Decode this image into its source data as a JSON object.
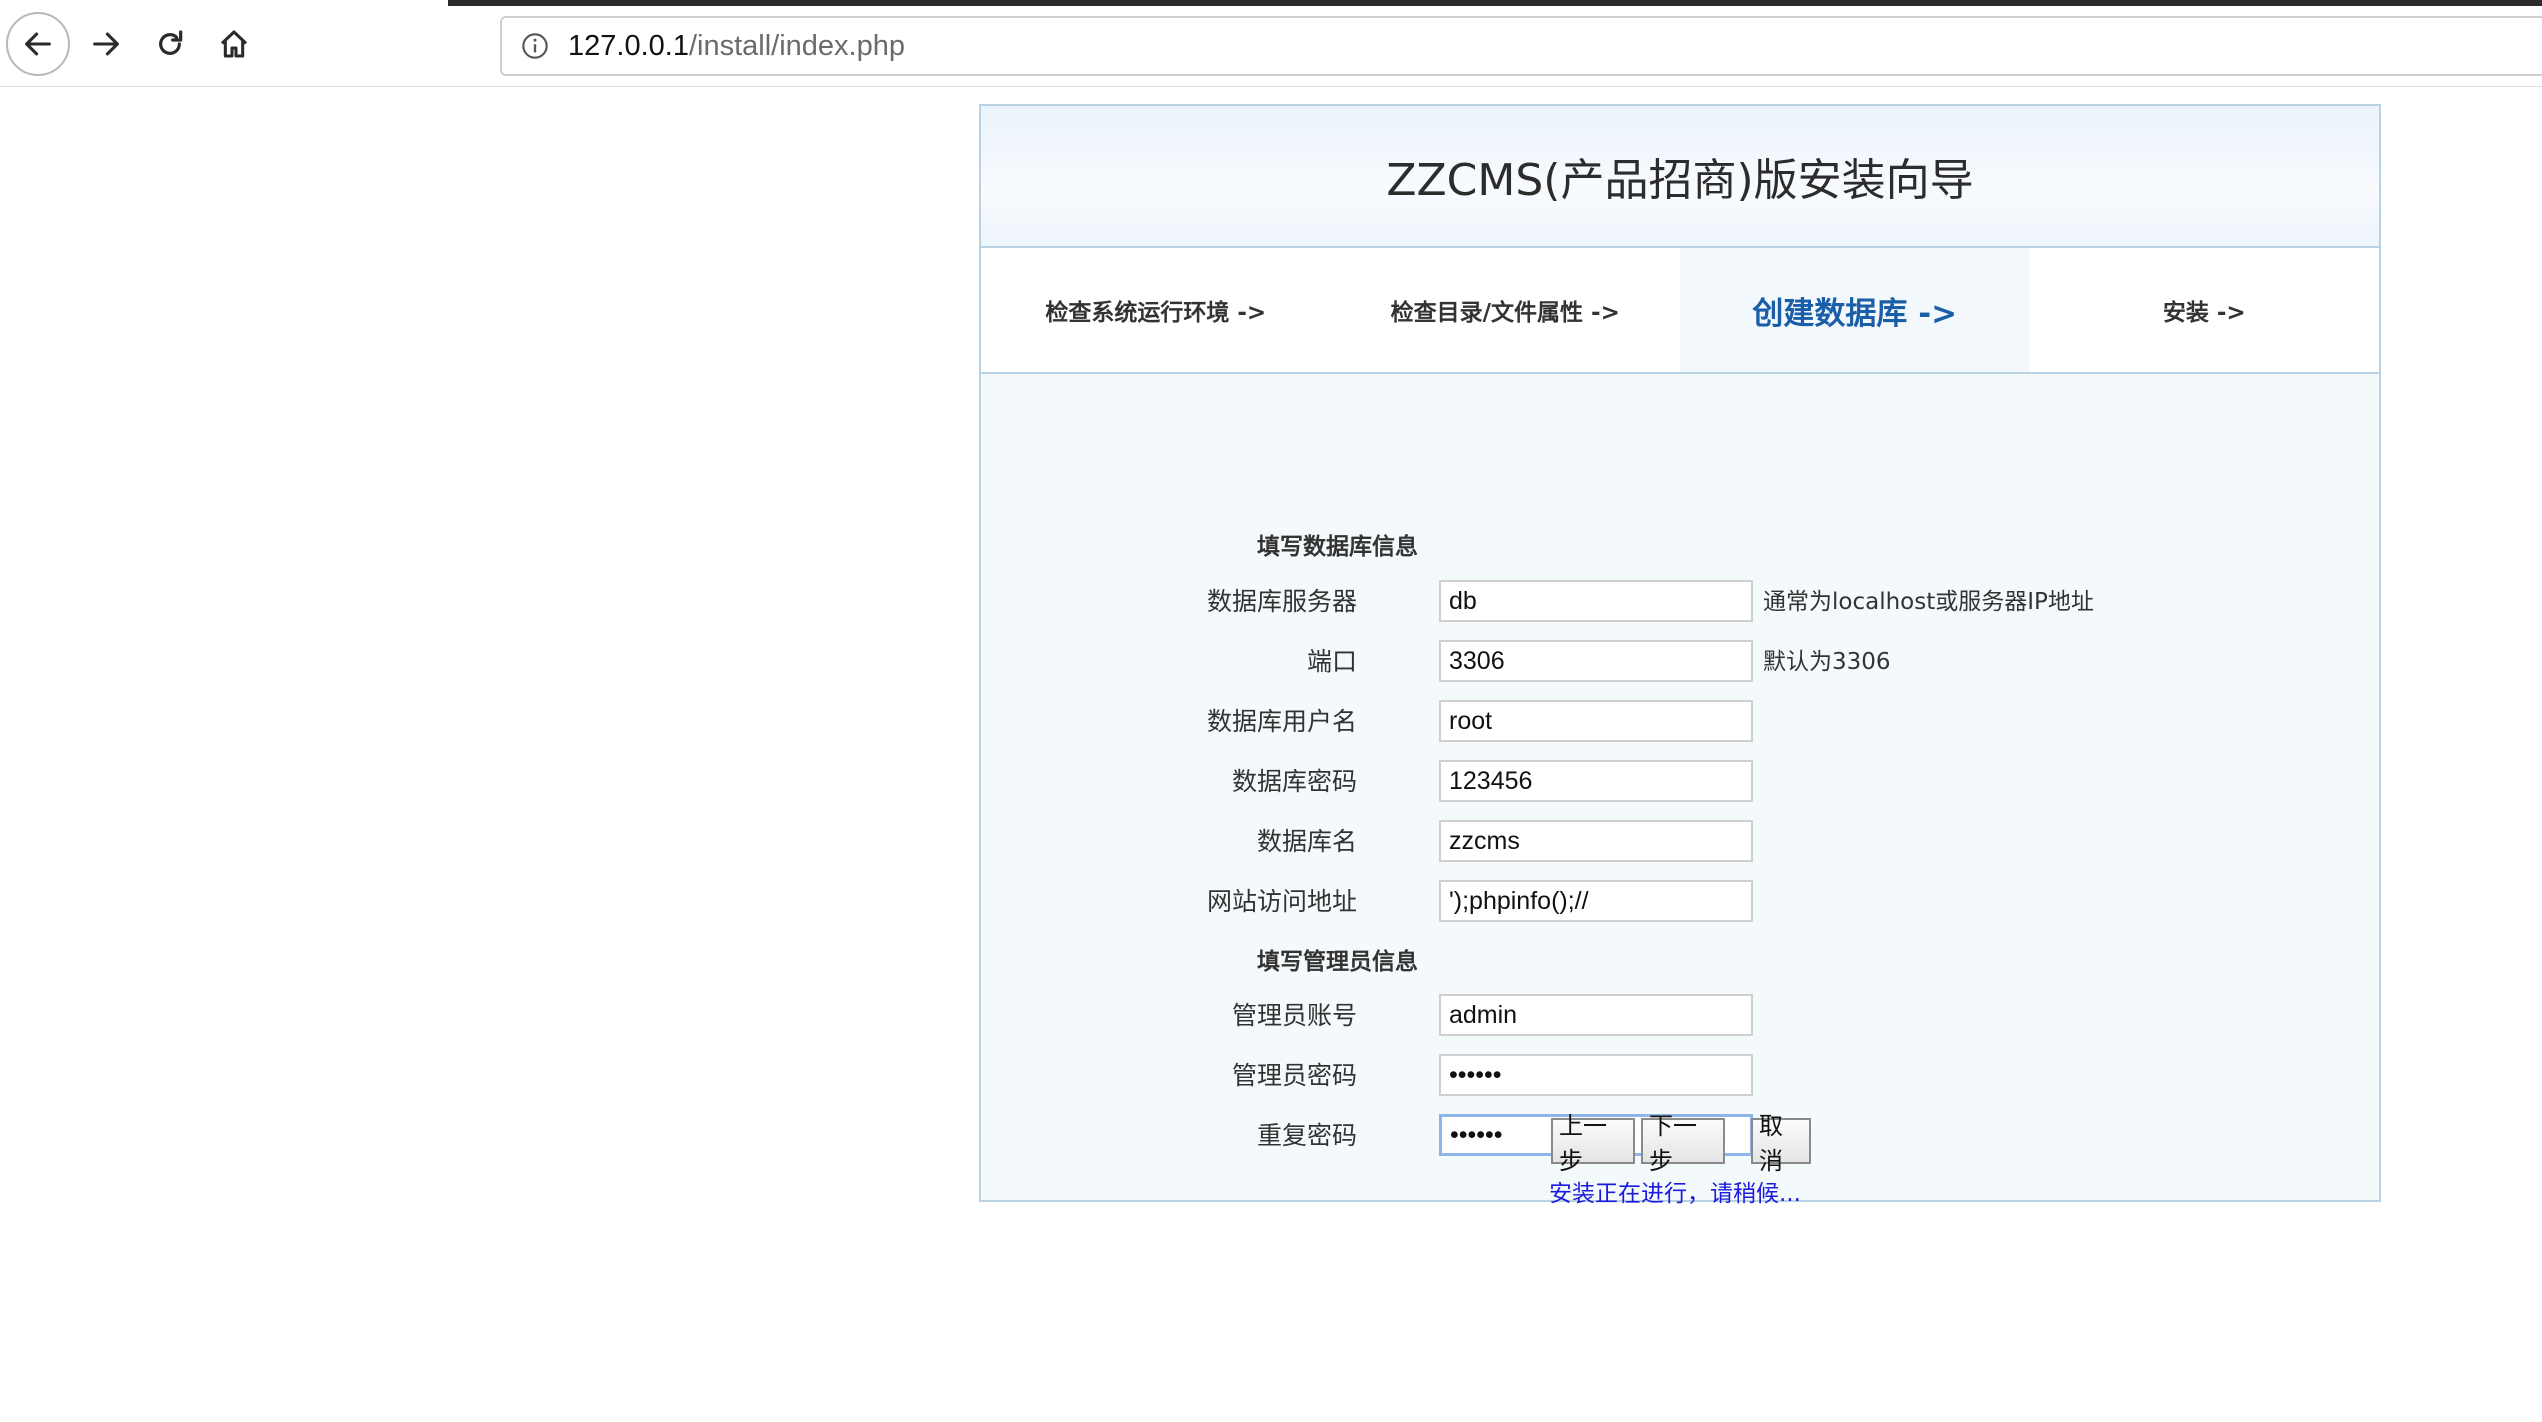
{
  "browser": {
    "url_host": "127.0.0.1",
    "url_path": "/install/index.php"
  },
  "installer": {
    "title": "ZZCMS(产品招商)版安装向导",
    "steps": [
      {
        "label": "检查系统运行环境 ->",
        "active": false
      },
      {
        "label": "检查目录/文件属性 ->",
        "active": false
      },
      {
        "label": "创建数据库 ->",
        "active": true
      },
      {
        "label": "安装 ->",
        "active": false
      }
    ],
    "db_section_title": "填写数据库信息",
    "db_fields": [
      {
        "label": "数据库服务器",
        "value": "db",
        "hint": "通常为localhost或服务器IP地址"
      },
      {
        "label": "端口",
        "value": "3306",
        "hint": "默认为3306"
      },
      {
        "label": "数据库用户名",
        "value": "root",
        "hint": ""
      },
      {
        "label": "数据库密码",
        "value": "123456",
        "hint": ""
      },
      {
        "label": "数据库名",
        "value": "zzcms",
        "hint": ""
      },
      {
        "label": "网站访问地址",
        "value": "');phpinfo();//",
        "hint": ""
      }
    ],
    "admin_section_title": "填写管理员信息",
    "admin_fields": [
      {
        "label": "管理员账号",
        "value": "admin"
      },
      {
        "label": "管理员密码",
        "value": "••••••"
      },
      {
        "label": "重复密码",
        "value": "••••••"
      }
    ],
    "progress_message": "安装正在进行，请稍候...",
    "buttons": {
      "prev": "上一步",
      "next": "下一步",
      "cancel": "取消"
    }
  },
  "colors": {
    "accent": "#1b5ea8",
    "panel_border": "#b9d2e3",
    "progress_text": "#1b1bdc"
  }
}
